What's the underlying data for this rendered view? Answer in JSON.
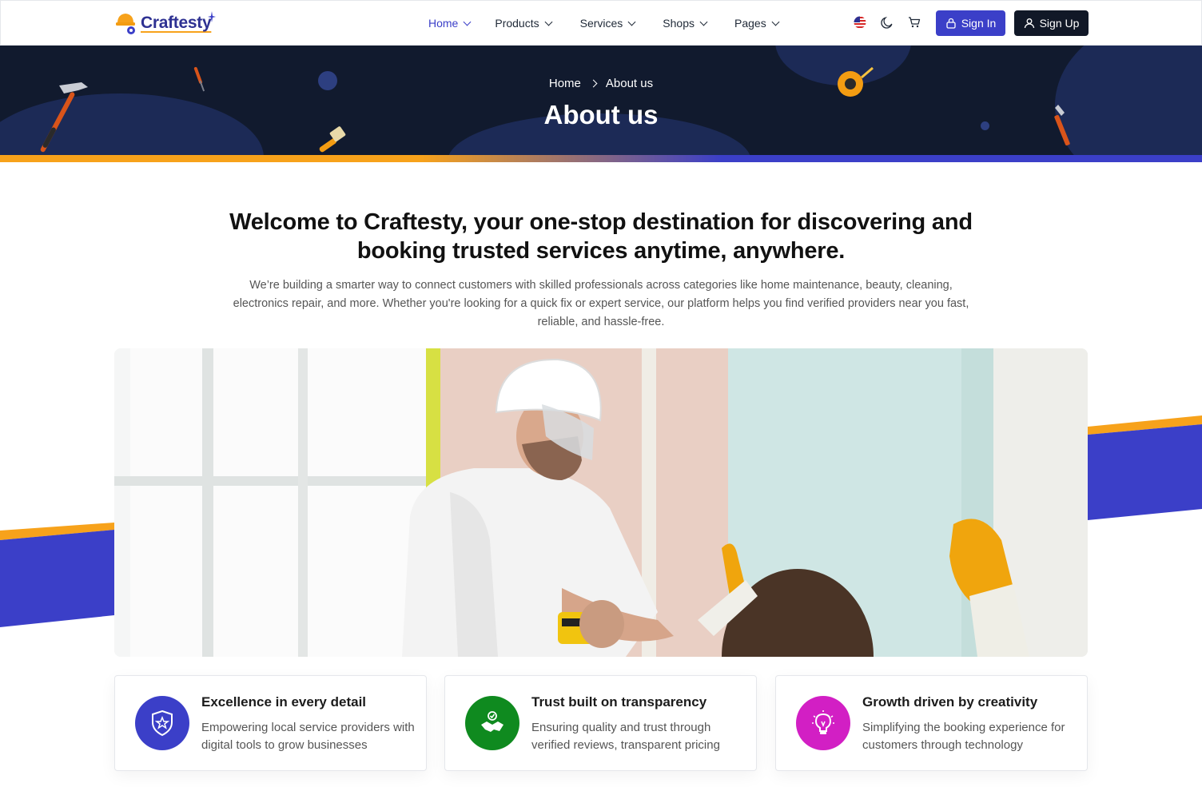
{
  "header": {
    "logo_text": "Craftesty",
    "nav": [
      {
        "label": "Home",
        "active": true
      },
      {
        "label": "Products",
        "active": false
      },
      {
        "label": "Services",
        "active": false
      },
      {
        "label": "Shops",
        "active": false
      },
      {
        "label": "Pages",
        "active": false
      }
    ],
    "icons": [
      "us-flag-icon",
      "moon-icon",
      "cart-icon"
    ],
    "signin_label": "Sign In",
    "signup_label": "Sign Up"
  },
  "hero": {
    "breadcrumb_home": "Home",
    "breadcrumb_current": "About us",
    "title": "About us"
  },
  "intro": {
    "title": "Welcome to Craftesty, your one-stop destination for discovering and booking trusted services anytime, anywhere.",
    "description": "We’re building a smarter way to connect customers with skilled professionals across categories like home maintenance, beauty, cleaning, electronics repair, and more. Whether you're looking for a quick fix or expert service, our platform helps you find verified providers near you  fast, reliable, and hassle-free."
  },
  "features": [
    {
      "title": "Excellence in every detail",
      "description": "Empowering local service providers with digital tools to grow businesses",
      "icon": "award-badge-icon",
      "color": "#3b3fc8"
    },
    {
      "title": "Trust built on transparency",
      "description": "Ensuring quality and trust through verified reviews, transparent pricing",
      "icon": "handshake-icon",
      "color": "#0f8a1f"
    },
    {
      "title": "Growth driven by creativity",
      "description": "Simplifying the booking experience for customers through technology",
      "icon": "lightbulb-icon",
      "color": "#d21fc4"
    }
  ],
  "colors": {
    "primary": "#3b3fc8",
    "accent": "#f7a21b",
    "dark": "#111a2e"
  }
}
